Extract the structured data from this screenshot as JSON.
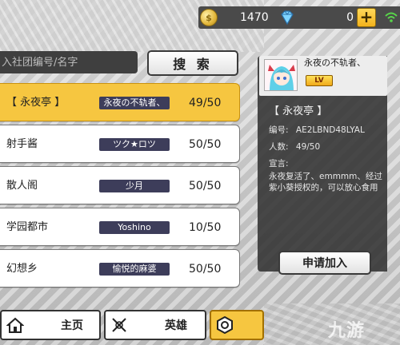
{
  "currency": {
    "coins": "1470",
    "gems": "0",
    "plus_label": "+"
  },
  "search": {
    "placeholder": "入社团编号/名字",
    "button_label": "搜 索"
  },
  "guilds": [
    {
      "name": "【 永夜亭 】",
      "leader": "永夜の不轨者、",
      "members": "49/50",
      "selected": true
    },
    {
      "name": "射手酱",
      "leader": "ツク★ロツ",
      "members": "50/50",
      "selected": false
    },
    {
      "name": "散人阁",
      "leader": "少月",
      "members": "50/50",
      "selected": false
    },
    {
      "name": "学园都市",
      "leader": "Yoshino",
      "members": "10/50",
      "selected": false
    },
    {
      "name": "幻想乡",
      "leader": "愉悦的麻婆",
      "members": "50/50",
      "selected": false
    }
  ],
  "detail": {
    "leader_name": "永夜の不轨者、",
    "level_badge": "LV",
    "title": "【 永夜亭 】",
    "id_label": "编号:",
    "id_value": "AE2LBND48LYAL",
    "members_label": "人数:",
    "members_value": "49/50",
    "manifesto_label": "宣言:",
    "manifesto": "永夜复活了、emmmm、经过紫小葵授权的，可以放心食用",
    "apply_label": "申请加入"
  },
  "nav": {
    "home_label": "主页",
    "hero_label": "英雄"
  },
  "watermark": "九游",
  "colors": {
    "selected_row": "#f6c640",
    "tag_bg": "#3d3d5a",
    "panel_bg": "#323232"
  }
}
